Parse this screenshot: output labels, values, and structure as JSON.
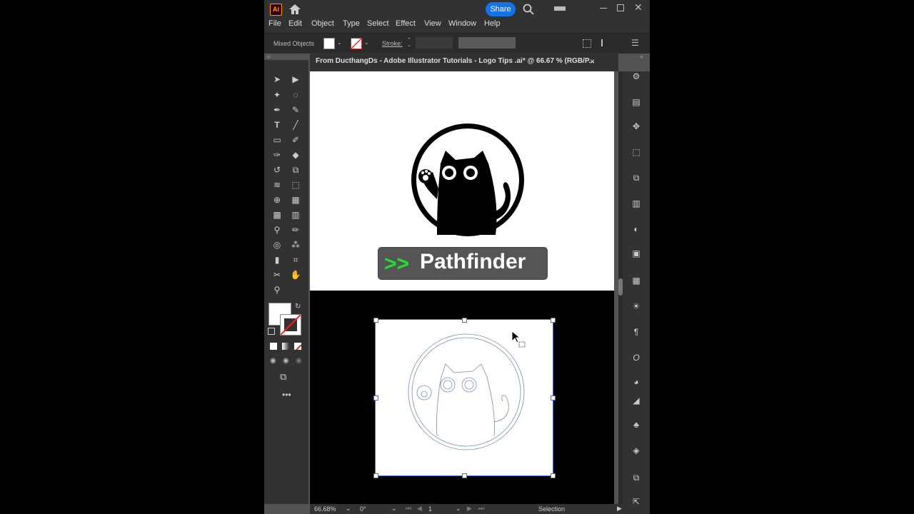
{
  "titlebar": {
    "logo": "Ai",
    "share_label": "Share"
  },
  "menu": [
    "File",
    "Edit",
    "Object",
    "Type",
    "Select",
    "Effect",
    "View",
    "Window",
    "Help"
  ],
  "controlbar": {
    "selection_type": "Mixed Objects",
    "stroke_label": "Stroke:"
  },
  "document_tab": {
    "title": "From DucthangDs - Adobe Illustrator Tutorials - Logo Tips .ai* @ 66.67 % (RGB/P...",
    "close": "×"
  },
  "artwork": {
    "badge_arrows": ">>",
    "badge_text": "Pathfinder"
  },
  "status": {
    "zoom": "66.68%",
    "rotation": "0°",
    "artboard_num": "1",
    "tool": "Selection"
  },
  "colors": {
    "app_bg": "#535353",
    "panel": "#323232",
    "accent": "#1473e6",
    "badge_arrows": "#22e02a"
  }
}
